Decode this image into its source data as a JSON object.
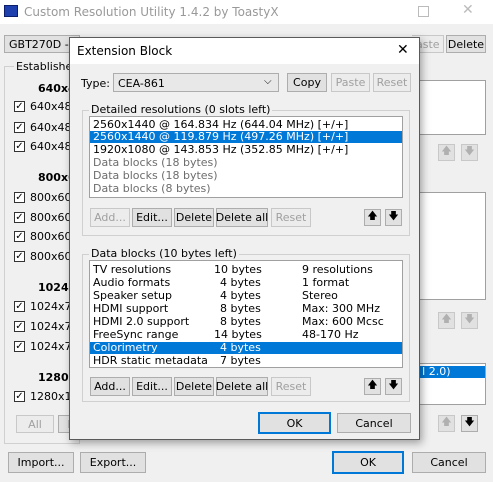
{
  "main_window": {
    "title": "Custom Resolution Utility 1.4.2 by ToastyX",
    "monitor_select": "GBT270D - M",
    "paste_label": "aste",
    "delete_label": "Delete",
    "established_label": "Established",
    "groups": [
      {
        "header": "640x48",
        "items": [
          "640x480",
          "640x480",
          "640x480"
        ]
      },
      {
        "header": "800x60",
        "items": [
          "800x600",
          "800x600",
          "800x600",
          "800x600"
        ]
      },
      {
        "header": "1024x7",
        "items": [
          "1024x76",
          "1024x76",
          "1024x76"
        ]
      },
      {
        "header": "1280x1",
        "items": [
          "1280x10"
        ]
      }
    ],
    "all_label": "All",
    "no_label": "N",
    "partial_text": "I 2.0)",
    "import_label": "Import...",
    "export_label": "Export...",
    "ok_label": "OK",
    "cancel_label": "Cancel"
  },
  "dialog": {
    "title": "Extension Block",
    "close_glyph": "✕",
    "type_label": "Type:",
    "type_value": "CEA-861",
    "copy_label": "Copy",
    "paste_label": "Paste",
    "reset_label": "Reset",
    "detailed": {
      "title": "Detailed resolutions (0 slots left)",
      "items": [
        "2560x1440 @ 164.834 Hz (644.04 MHz) [+/+]",
        "2560x1440 @ 119.879 Hz (497.26 MHz) [+/+]",
        "1920x1080 @ 143.853 Hz (352.85 MHz) [+/+]",
        "Data blocks (18 bytes)",
        "Data blocks (18 bytes)",
        "Data blocks (8 bytes)"
      ],
      "selected_index": 1
    },
    "datablocks": {
      "title": "Data blocks (10 bytes left)",
      "items": [
        {
          "name": "TV resolutions",
          "size": "10 bytes",
          "info": "9 resolutions"
        },
        {
          "name": "Audio formats",
          "size": "4 bytes",
          "info": "1 format"
        },
        {
          "name": "Speaker setup",
          "size": "4 bytes",
          "info": "Stereo"
        },
        {
          "name": "HDMI support",
          "size": "8 bytes",
          "info": "Max: 300 MHz"
        },
        {
          "name": "HDMI 2.0 support",
          "size": "8 bytes",
          "info": "Max: 600 Mcsc"
        },
        {
          "name": "FreeSync range",
          "size": "14 bytes",
          "info": "48-170 Hz"
        },
        {
          "name": "Colorimetry",
          "size": "4 bytes",
          "info": ""
        },
        {
          "name": "HDR static metadata",
          "size": "7 bytes",
          "info": ""
        }
      ],
      "selected_index": 6
    },
    "add_label": "Add...",
    "edit_label": "Edit...",
    "delete_label": "Delete",
    "delete_all_label": "Delete all",
    "reset2_label": "Reset",
    "ok_label": "OK",
    "cancel_label": "Cancel",
    "up_glyph": "🡅",
    "down_glyph": "🡇"
  }
}
